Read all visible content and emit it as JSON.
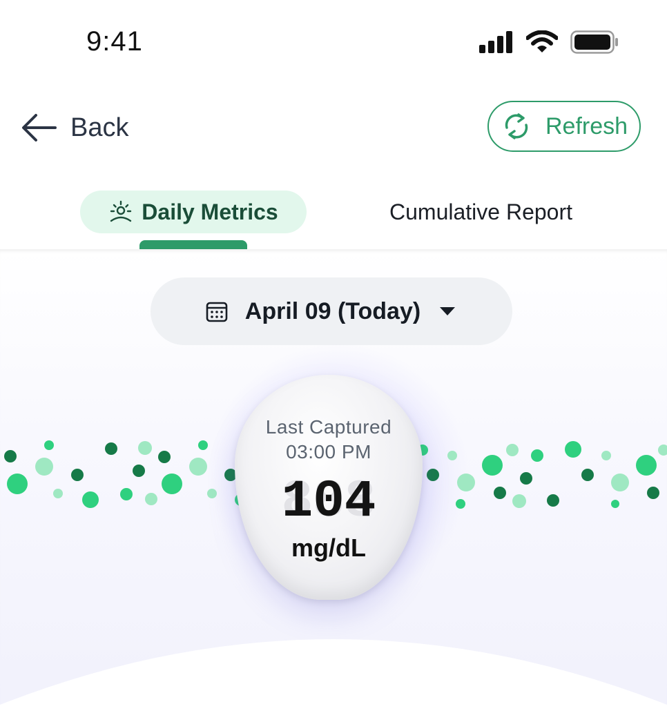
{
  "status_bar": {
    "time": "9:41",
    "icons": [
      "cellular-signal-icon",
      "wifi-icon",
      "battery-icon"
    ]
  },
  "header": {
    "back_label": "Back",
    "refresh_label": "Refresh"
  },
  "tabs": [
    {
      "label": "Daily Metrics",
      "icon": "sun-horizon-icon",
      "active": true
    },
    {
      "label": "Cumulative Report",
      "active": false
    }
  ],
  "date_picker": {
    "label": "April 09 (Today)",
    "icon": "calendar-icon"
  },
  "reading": {
    "caption_line1": "Last Captured",
    "caption_line2": "03:00 PM",
    "value": "104",
    "unit": "mg/dL"
  },
  "colors": {
    "accent": "#2d9b69",
    "dark_green": "#167a48",
    "light_green": "#9fe8c2",
    "mid_green": "#2fd07f"
  }
}
